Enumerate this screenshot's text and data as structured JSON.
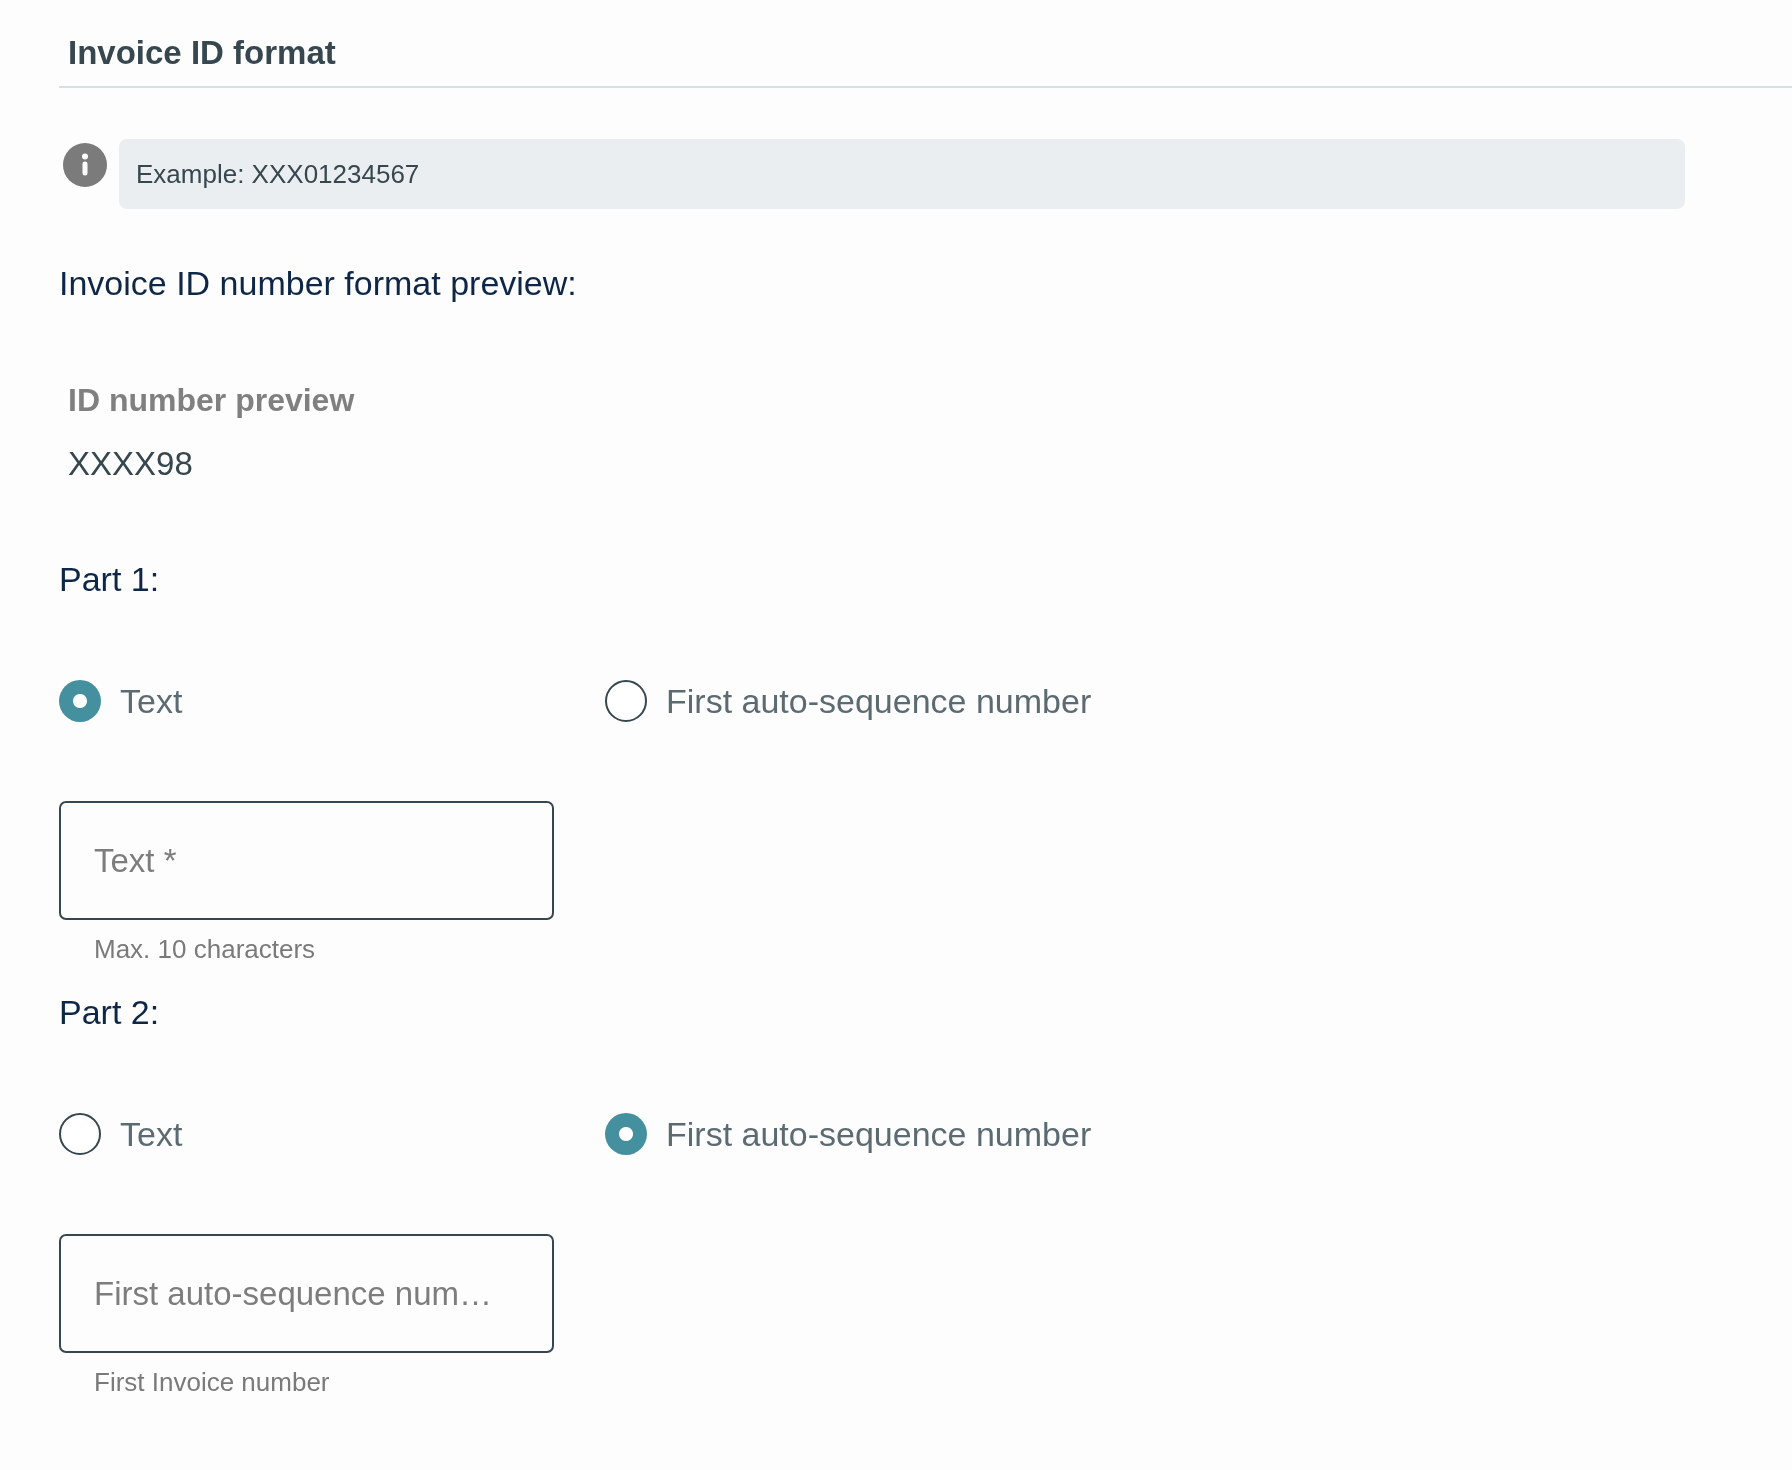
{
  "section": {
    "title": "Invoice ID format"
  },
  "info": {
    "text": "Example: XXX01234567"
  },
  "preview": {
    "heading": "Invoice ID number format preview:",
    "label": "ID number preview",
    "value": "XXXX98"
  },
  "parts": [
    {
      "heading": "Part 1:",
      "options": [
        {
          "label": "Text",
          "selected": true
        },
        {
          "label": "First auto-sequence number",
          "selected": false
        }
      ],
      "field": {
        "placeholder": "Text *",
        "helper": "Max. 10 characters"
      }
    },
    {
      "heading": "Part 2:",
      "options": [
        {
          "label": "Text",
          "selected": false
        },
        {
          "label": "First auto-sequence number",
          "selected": true
        }
      ],
      "field": {
        "placeholder": "First auto-sequence num…",
        "helper": "First Invoice number"
      }
    }
  ]
}
